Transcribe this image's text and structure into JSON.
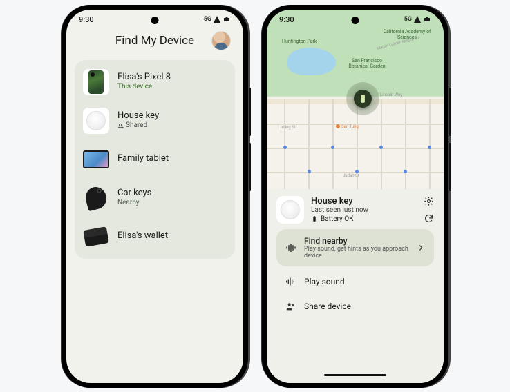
{
  "status": {
    "time": "9:30",
    "net": "5G"
  },
  "phone_a": {
    "title": "Find My Device",
    "devices": [
      {
        "name": "Elisa's Pixel 8",
        "sub": "This device",
        "sub_kind": "this"
      },
      {
        "name": "House key",
        "sub": "Shared",
        "sub_kind": "shared"
      },
      {
        "name": "Family tablet",
        "sub": "",
        "sub_kind": ""
      },
      {
        "name": "Car keys",
        "sub": "Nearby",
        "sub_kind": "nearby"
      },
      {
        "name": "Elisa's wallet",
        "sub": "",
        "sub_kind": ""
      }
    ]
  },
  "phone_b": {
    "map": {
      "park1": "San Francisco Botanical Garden",
      "park2": "California Academy of Sciences",
      "park3": "Huntington Park",
      "street1": "Martin Luther King Jr Dr",
      "street2": "Lincoln Way",
      "street3": "Irving St",
      "street4": "Judah St",
      "poi1": "San Tung"
    },
    "device": {
      "name": "House key",
      "last_seen": "Last seen just now",
      "battery": "Battery OK"
    },
    "actions": {
      "find_title": "Find nearby",
      "find_sub": "Play sound, get hints as you approach device",
      "play": "Play sound",
      "share": "Share device"
    }
  }
}
